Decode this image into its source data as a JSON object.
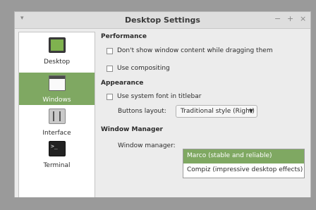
{
  "window": {
    "title": "Desktop Settings",
    "controls": {
      "minimize": "−",
      "maximize": "+",
      "close": "×"
    },
    "menu_glyph": "▾"
  },
  "sidebar": {
    "items": [
      {
        "label": "Desktop",
        "icon": "desktop-icon",
        "selected": false
      },
      {
        "label": "Windows",
        "icon": "windows-icon",
        "selected": true
      },
      {
        "label": "Interface",
        "icon": "interface-icon",
        "selected": false
      },
      {
        "label": "Terminal",
        "icon": "terminal-icon",
        "selected": false
      }
    ],
    "terminal_glyph": ">_"
  },
  "sections": {
    "performance": {
      "title": "Performance",
      "options": [
        {
          "label": "Don't show window content while dragging them",
          "checked": false
        },
        {
          "label": "Use compositing",
          "checked": false
        }
      ]
    },
    "appearance": {
      "title": "Appearance",
      "options": [
        {
          "label": "Use system font in titlebar",
          "checked": false
        }
      ],
      "buttons_layout_label": "Buttons layout:",
      "buttons_layout_value": "Traditional style (Right)"
    },
    "window_manager": {
      "title": "Window Manager",
      "label": "Window manager:",
      "options": [
        {
          "label": "Marco (stable and reliable)",
          "selected": true
        },
        {
          "label": "Compiz (impressive desktop effects)",
          "selected": false
        }
      ]
    }
  },
  "colors": {
    "accent": "#7fa862",
    "window_bg": "#ececec",
    "sidebar_bg": "#ffffff",
    "backdrop": "#9a9a9a"
  }
}
